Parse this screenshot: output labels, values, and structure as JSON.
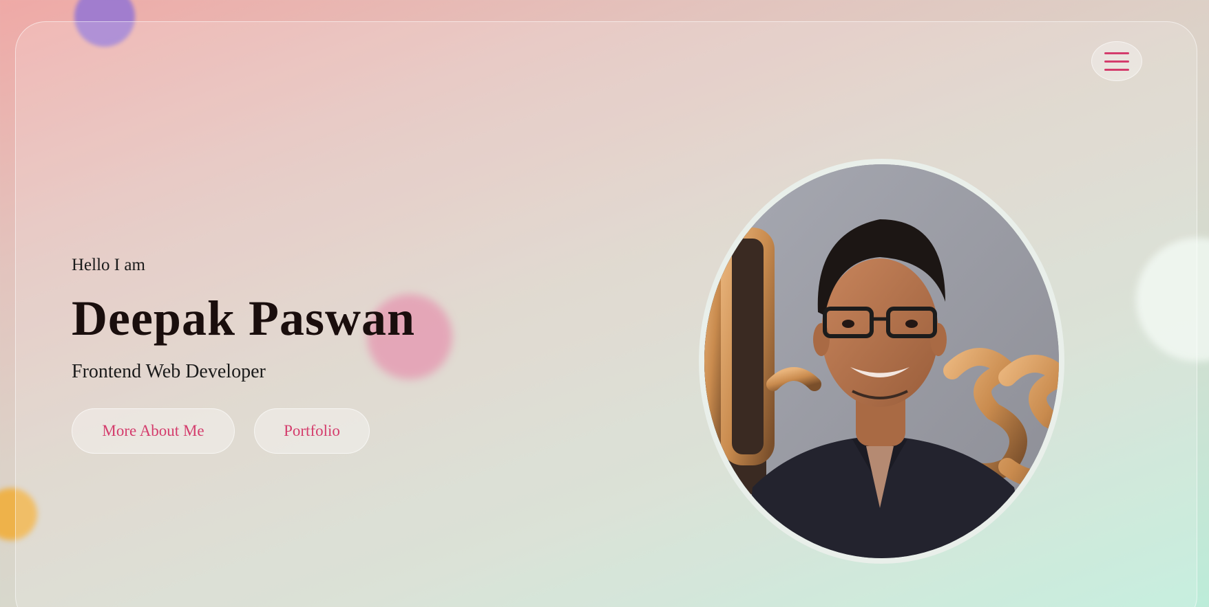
{
  "header": {
    "menu_icon": "hamburger-menu-icon",
    "menu_color": "#d43c6c"
  },
  "hero": {
    "greeting": "Hello I am",
    "name": "Deepak Paswan",
    "role": "Frontend Web Developer",
    "buttons": {
      "about_label": "More About Me",
      "portfolio_label": "Portfolio"
    },
    "accent_color": "#d43c6c"
  },
  "profile_photo": {
    "alt": "Deepak Paswan"
  }
}
